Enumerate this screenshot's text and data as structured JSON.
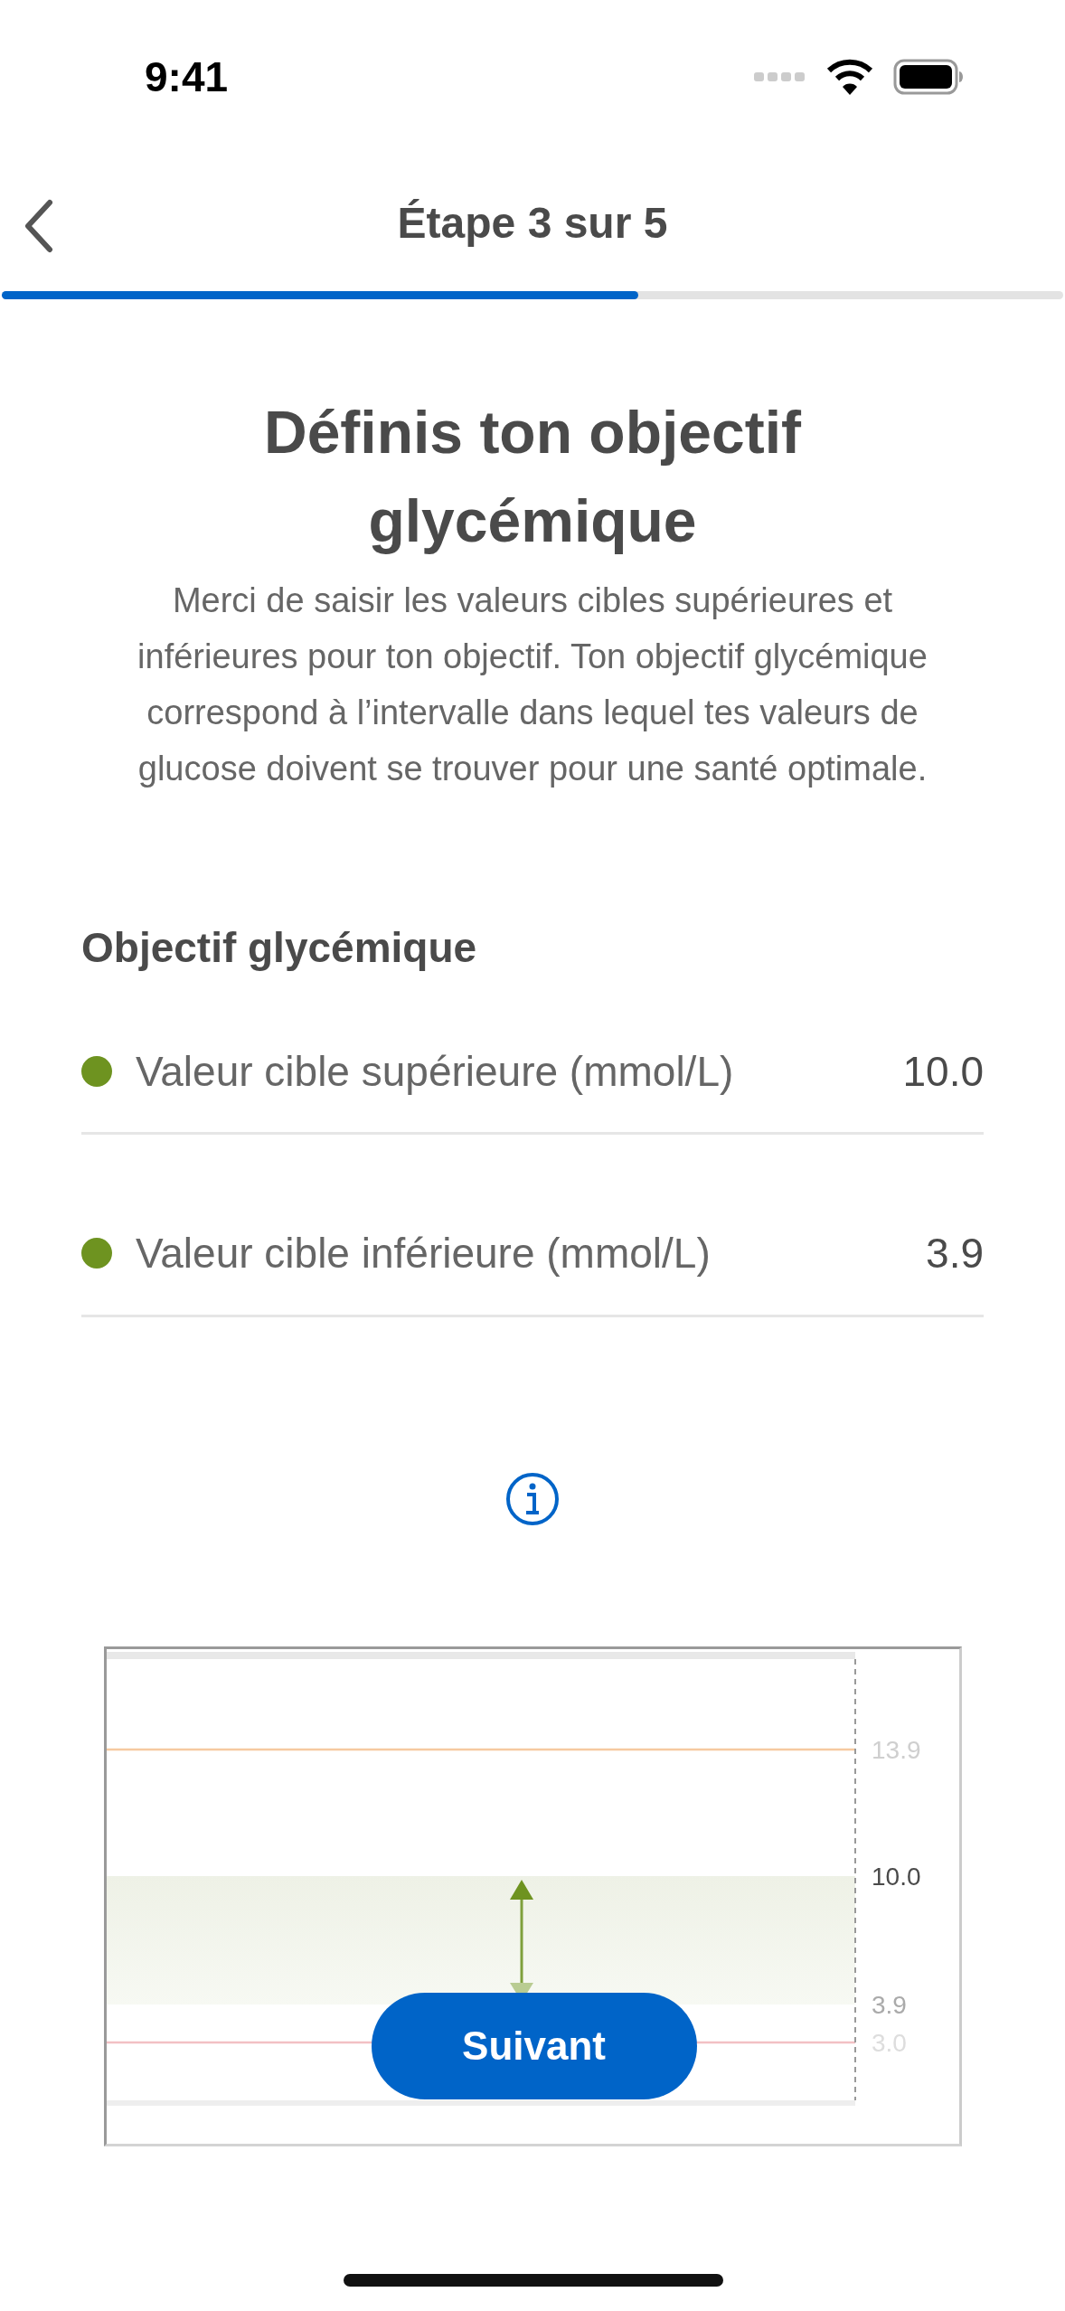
{
  "status_bar": {
    "time": "9:41"
  },
  "header": {
    "title": "Étape 3 sur 5",
    "progress": {
      "level": 0.6
    }
  },
  "intro": {
    "title": "Définis ton objectif glycémique",
    "text": "Merci de saisir les valeurs cibles supérieures et inférieures pour ton objectif. Ton objectif glycémique correspond à l’intervalle dans lequel tes valeurs de glucose doivent se trouver pour une santé optimale."
  },
  "target": {
    "heading": "Objectif glycémique",
    "rows": [
      {
        "label": "Valeur cible supérieure (mmol/L)",
        "value": "10.0"
      },
      {
        "label": "Valeur cible inférieure (mmol/L)",
        "value": "3.9"
      }
    ]
  },
  "range_diagram": {
    "labels": [
      {
        "text": "13.9",
        "kind": "high"
      },
      {
        "text": "10.0",
        "kind": "target_top"
      },
      {
        "text": "3.9",
        "kind": "target_bottom"
      },
      {
        "text": "3.0",
        "kind": "low"
      }
    ]
  },
  "next_button": {
    "label": "Suivant"
  }
}
